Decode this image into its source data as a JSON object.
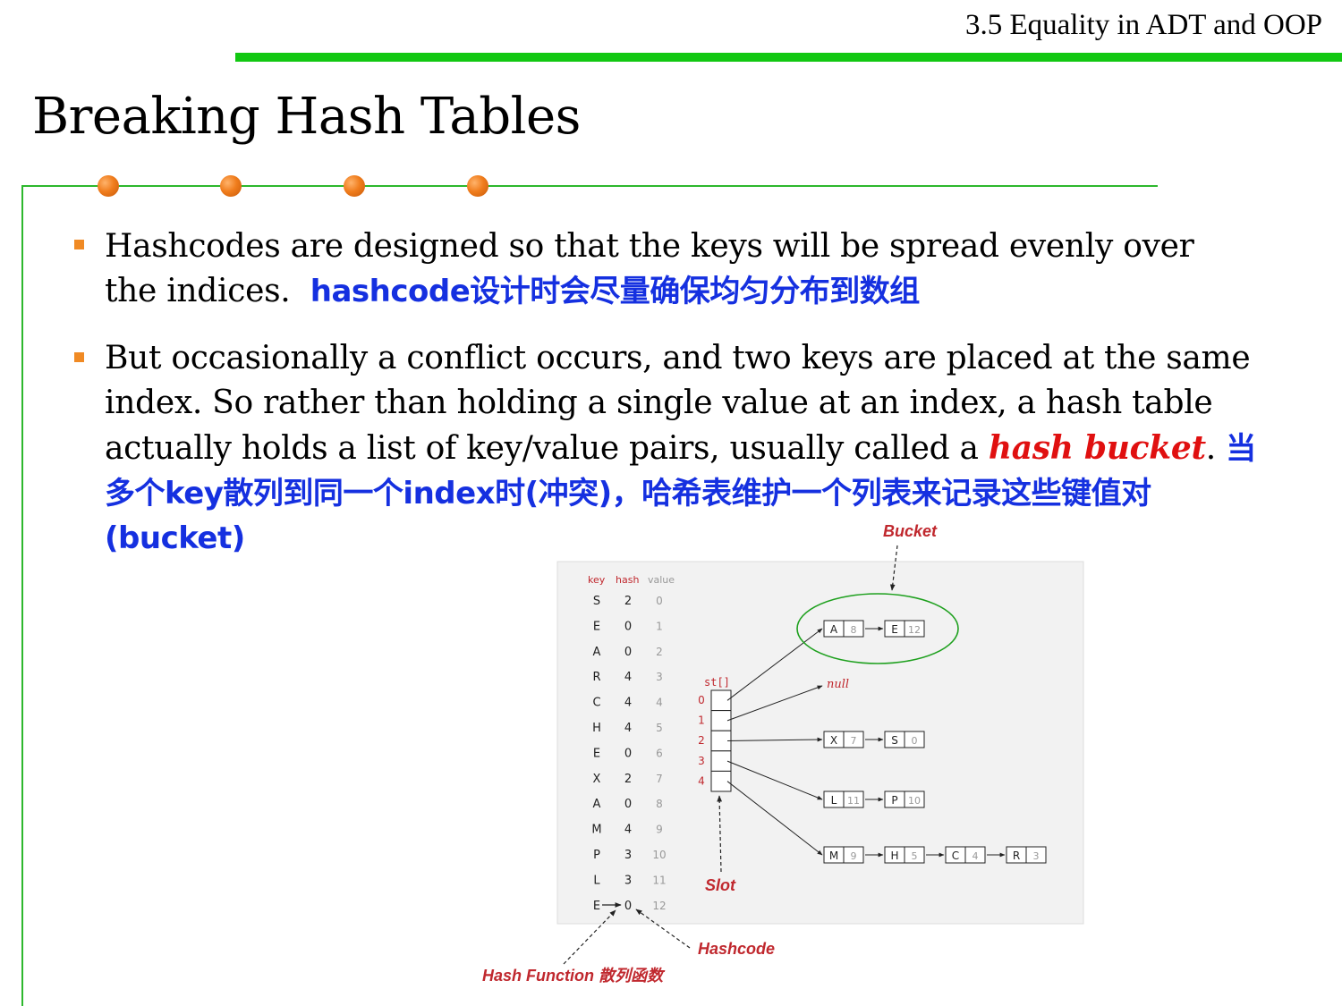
{
  "header": {
    "section": "3.5 Equality in ADT and OOP"
  },
  "slide": {
    "title": "Breaking Hash Tables"
  },
  "bullets": [
    {
      "text": "Hashcodes are designed so that the keys will be spread evenly over the indices.",
      "zh": "hashcode设计时会尽量确保均匀分布到数组"
    },
    {
      "text_before": "But occasionally a conflict occurs, and two keys are placed at the same index. So rather than holding a single value at an index, a hash table actually holds a list of key/value pairs, usually called a",
      "term": "hash bucket",
      "period": ".",
      "zh": "当多个key散列到同一个index时(冲突)，哈希表维护一个列表来记录这些键值对(bucket)"
    }
  ],
  "diagram": {
    "headers": {
      "key": "key",
      "hash": "hash",
      "value": "value"
    },
    "rows": [
      {
        "key": "S",
        "hash": "2",
        "value": "0"
      },
      {
        "key": "E",
        "hash": "0",
        "value": "1"
      },
      {
        "key": "A",
        "hash": "0",
        "value": "2"
      },
      {
        "key": "R",
        "hash": "4",
        "value": "3"
      },
      {
        "key": "C",
        "hash": "4",
        "value": "4"
      },
      {
        "key": "H",
        "hash": "4",
        "value": "5"
      },
      {
        "key": "E",
        "hash": "0",
        "value": "6"
      },
      {
        "key": "X",
        "hash": "2",
        "value": "7"
      },
      {
        "key": "A",
        "hash": "0",
        "value": "8"
      },
      {
        "key": "M",
        "hash": "4",
        "value": "9"
      },
      {
        "key": "P",
        "hash": "3",
        "value": "10"
      },
      {
        "key": "L",
        "hash": "3",
        "value": "11"
      },
      {
        "key": "E",
        "hash": "0",
        "value": "12"
      }
    ],
    "array_label": "st[]",
    "indices": [
      "0",
      "1",
      "2",
      "3",
      "4"
    ],
    "null_label": "null",
    "chains": [
      [
        {
          "k": "A",
          "v": "8"
        },
        {
          "k": "E",
          "v": "12"
        }
      ],
      [
        {
          "k": "X",
          "v": "7"
        },
        {
          "k": "S",
          "v": "0"
        }
      ],
      [
        {
          "k": "L",
          "v": "11"
        },
        {
          "k": "P",
          "v": "10"
        }
      ],
      [
        {
          "k": "M",
          "v": "9"
        },
        {
          "k": "H",
          "v": "5"
        },
        {
          "k": "C",
          "v": "4"
        },
        {
          "k": "R",
          "v": "3"
        }
      ]
    ],
    "labels": {
      "bucket": "Bucket",
      "slot": "Slot",
      "hashcode": "Hashcode",
      "hash_function": "Hash Function 散列函数"
    },
    "colors": {
      "annotation": "#c0282e",
      "bucket_ellipse": "#1ea01e",
      "panel": "#f2f2f2"
    }
  }
}
